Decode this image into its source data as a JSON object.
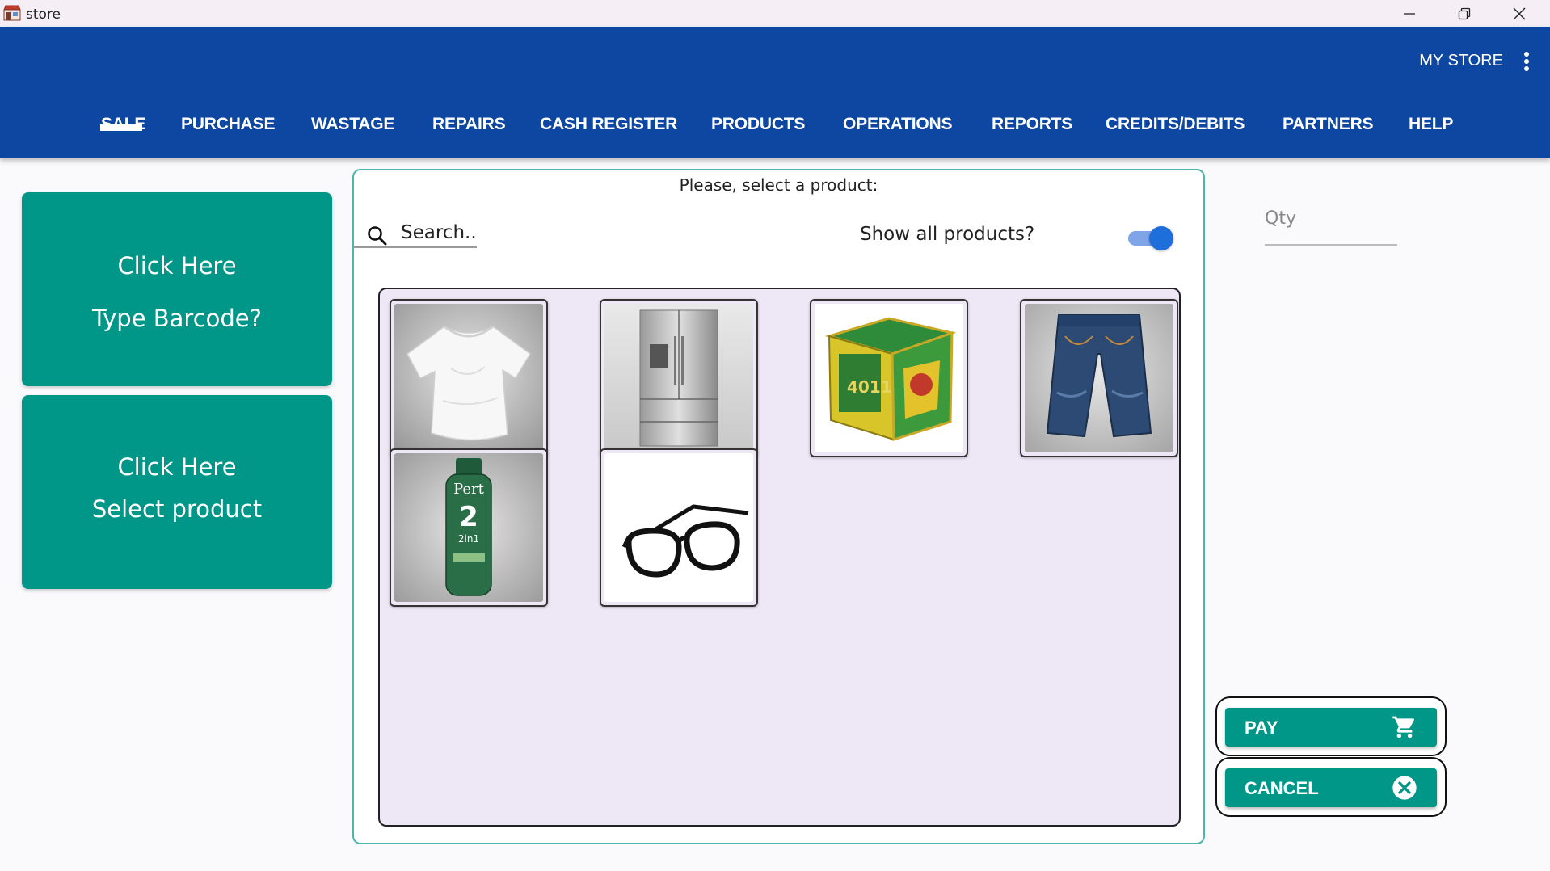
{
  "window": {
    "title": "store",
    "controls": [
      "minimize",
      "restore",
      "close"
    ]
  },
  "header": {
    "store_name": "MY STORE",
    "tabs": [
      {
        "label": "SALE",
        "active": true
      },
      {
        "label": "PURCHASE"
      },
      {
        "label": "WASTAGE"
      },
      {
        "label": "REPAIRS"
      },
      {
        "label": "CASH REGISTER"
      },
      {
        "label": "PRODUCTS"
      },
      {
        "label": "OPERATIONS"
      },
      {
        "label": "REPORTS"
      },
      {
        "label": "CREDITS/DEBITS"
      },
      {
        "label": "PARTNERS"
      },
      {
        "label": "HELP"
      }
    ]
  },
  "left": {
    "barcode_btn": {
      "line1": "Click Here",
      "line2": "Type Barcode?"
    },
    "select_btn": {
      "line1": "Click Here",
      "line2": "Select product"
    }
  },
  "panel": {
    "title": "Please, select a product:",
    "search_placeholder": "Search...",
    "show_all_label": "Show all products?",
    "show_all_on": true,
    "products": [
      {
        "icon": "tshirt-image"
      },
      {
        "icon": "refrigerator-image"
      },
      {
        "icon": "tea-box-image"
      },
      {
        "icon": "jeans-image"
      },
      {
        "icon": "shampoo-bottle-image"
      },
      {
        "icon": "eyeglasses-image"
      }
    ]
  },
  "right": {
    "qty_placeholder": "Qty",
    "pay_label": "PAY",
    "cancel_label": "CANCEL"
  },
  "colors": {
    "primary": "#0d47a1",
    "accent": "#009688",
    "grid_bg": "#ede7f6",
    "toggle": "#1e6fdc"
  }
}
